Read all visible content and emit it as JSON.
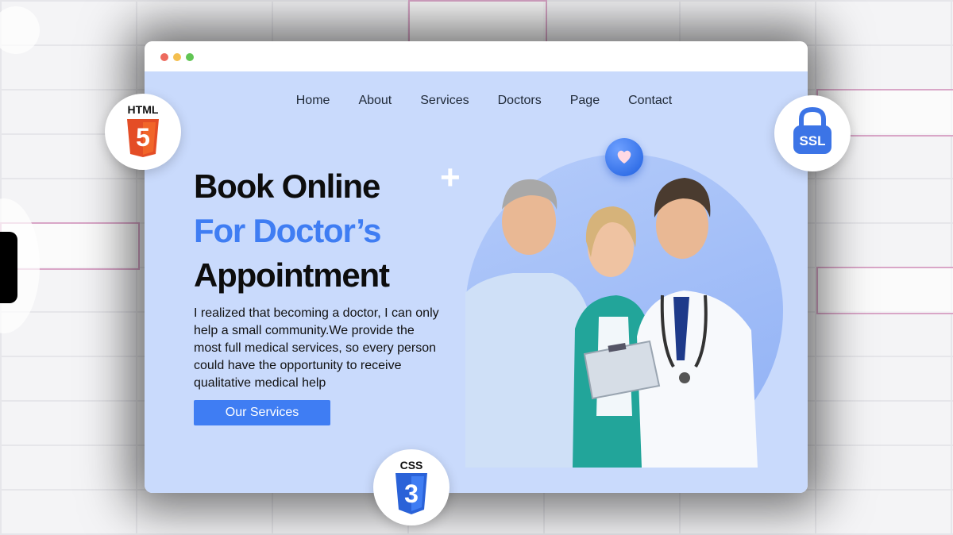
{
  "nav": {
    "items": [
      "Home",
      "About",
      "Services",
      "Doctors",
      "Page",
      "Contact"
    ]
  },
  "hero": {
    "title_line1": "Book Online",
    "title_line2": "For Doctor’s",
    "title_line3": "Appointment",
    "paragraph": "I realized that becoming a doctor, I can only help a small community.We provide the most full medical services, so every person could have the opportunity to receive qualitative medical help",
    "cta_label": "Our Services"
  },
  "badges": {
    "html_label": "HTML",
    "html_glyph": "5",
    "ssl_label": "SSL",
    "css_label": "CSS",
    "css_glyph": "3"
  },
  "icons": [
    "plus-icon",
    "heart-icon",
    "html5-icon",
    "ssl-lock-icon",
    "css3-icon"
  ],
  "colors": {
    "accent": "#3f7df3",
    "page_bg": "#c9dafc",
    "html_orange": "#e44d26",
    "css_blue": "#2a62d8",
    "ssl_blue": "#3c74e6",
    "dot_red": "#ed6a5e",
    "dot_yellow": "#f4bf4f",
    "dot_green": "#61c554"
  }
}
